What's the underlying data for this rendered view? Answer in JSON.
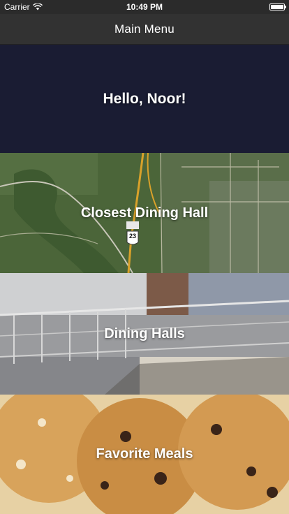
{
  "status_bar": {
    "carrier": "Carrier",
    "wifi_icon": "wifi-icon",
    "time": "10:49 PM",
    "battery_icon": "battery-icon"
  },
  "nav": {
    "title": "Main Menu"
  },
  "menu": {
    "greeting": "Hello, Noor!",
    "items": [
      {
        "label": "Closest Dining Hall",
        "background": "aerial map"
      },
      {
        "label": "Dining Halls",
        "background": "dining hall interior photo"
      },
      {
        "label": "Favorite Meals",
        "background": "cookies photo"
      }
    ],
    "map_route_marker": "23"
  },
  "colors": {
    "status_bar": "#2b2b2b",
    "nav_bar": "#323232",
    "greeting_bg": "#1a1c33"
  }
}
